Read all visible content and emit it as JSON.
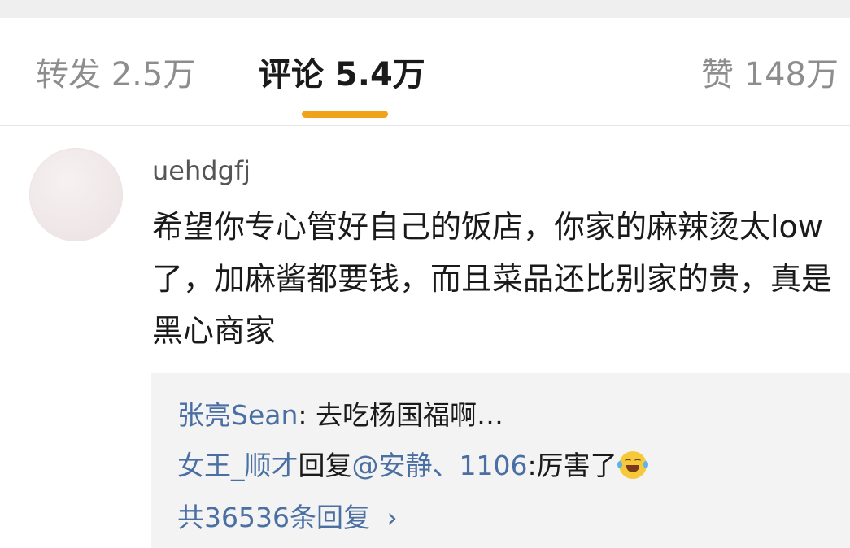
{
  "tabs": {
    "repost": "转发 2.5万",
    "comments": "评论 5.4万",
    "likes": "赞 148万"
  },
  "comment": {
    "username": "uehdgfj",
    "text": "希望你专心管好自己的饭店，你家的麻辣烫太low了，加麻酱都要钱，而且菜品还比别家的贵，真是黑心商家"
  },
  "replies": [
    {
      "author": "张亮Sean",
      "separator": ": ",
      "text": "去吃杨国福啊…"
    },
    {
      "author": "女王_顺才",
      "action": "回复",
      "mention": "@安静、1106",
      "text": ":厉害了",
      "emoji": "laughing-crying-emoji"
    }
  ],
  "more_replies": {
    "label": "共36536条回复",
    "chevron": "›"
  },
  "colors": {
    "accent": "#f0a218",
    "link": "#4a6fa3",
    "muted": "#8d8d8d"
  }
}
